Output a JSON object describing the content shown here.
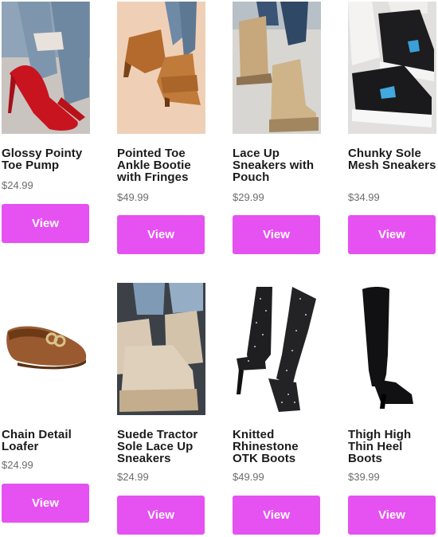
{
  "theme": {
    "button_color": "#e651f2",
    "button_text_color": "#ffffff",
    "price_color": "#6d6d6d",
    "name_color": "#1b1b1b"
  },
  "products": [
    {
      "name": "Glossy Pointy Toe Pump",
      "price": "$24.99",
      "button_label": "View",
      "image_icon": "red-pump-heel"
    },
    {
      "name": "Pointed Toe Ankle Bootie with Fringes",
      "price": "$49.99",
      "button_label": "View",
      "image_icon": "tan-fringe-bootie"
    },
    {
      "name": "Lace Up Sneakers with Pouch",
      "price": "$29.99",
      "button_label": "View",
      "image_icon": "beige-lace-up-boot"
    },
    {
      "name": "Chunky Sole Mesh Sneakers",
      "price": "$34.99",
      "button_label": "View",
      "image_icon": "black-chunky-sneaker"
    },
    {
      "name": "Chain Detail Loafer",
      "price": "$24.99",
      "button_label": "View",
      "image_icon": "brown-chain-loafer"
    },
    {
      "name": "Suede Tractor Sole Lace Up Sneakers",
      "price": "$24.99",
      "button_label": "View",
      "image_icon": "suede-tractor-boot"
    },
    {
      "name": "Knitted Rhinestone OTK Boots",
      "price": "$49.99",
      "button_label": "View",
      "image_icon": "rhinestone-otk-boot"
    },
    {
      "name": "Thigh High Thin Heel Boots",
      "price": "$39.99",
      "button_label": "View",
      "image_icon": "black-thigh-high-boot"
    }
  ]
}
